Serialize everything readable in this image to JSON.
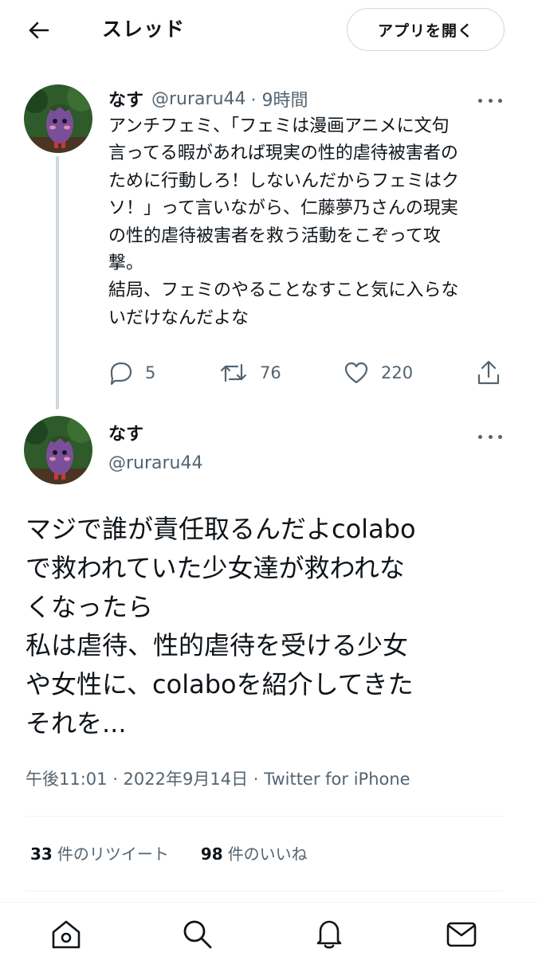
{
  "header": {
    "title": "スレッド",
    "open_app_label": "アプリを開く"
  },
  "tweet1": {
    "name": "なす",
    "handle": "@ruraru44",
    "time": "· 9時間",
    "lines": [
      "アンチフェミ、「フェミは漫画アニメに文句",
      "言ってる暇があれば現実の性的虐待被害者の",
      "ために行動しろ！しないんだからフェミはク",
      "ソ！」って言いながら、仁藤夢乃さんの現実",
      "の性的虐待被害者を救う活動をこぞって攻",
      "撃。",
      "結局、フェミのやることなすこと気に入らな",
      "いだけなんだよな"
    ],
    "replies": "5",
    "retweets": "76",
    "likes": "220"
  },
  "tweet2": {
    "name": "なす",
    "handle": "@ruraru44",
    "lines": [
      "マジで誰が責任取るんだよcolabo",
      "で救われていた少女達が救われな",
      "くなったら",
      "私は虐待、性的虐待を受ける少女",
      "や女性に、colaboを紹介してきた",
      "それを..."
    ],
    "meta": "午後11:01 · 2022年9月14日 · Twitter for iPhone",
    "retweet_count": "33",
    "retweet_label": "件のリツイート",
    "like_count": "98",
    "like_label": "件のいいね"
  },
  "tabs": [
    "home-icon",
    "search-icon",
    "notifications-icon",
    "messages-icon"
  ],
  "colors": {
    "text": "#0f1419",
    "muted": "#536471",
    "border": "#cfd9de",
    "avatar_bg": "#2f5a2a",
    "eggplant": "#7a4f9a"
  }
}
